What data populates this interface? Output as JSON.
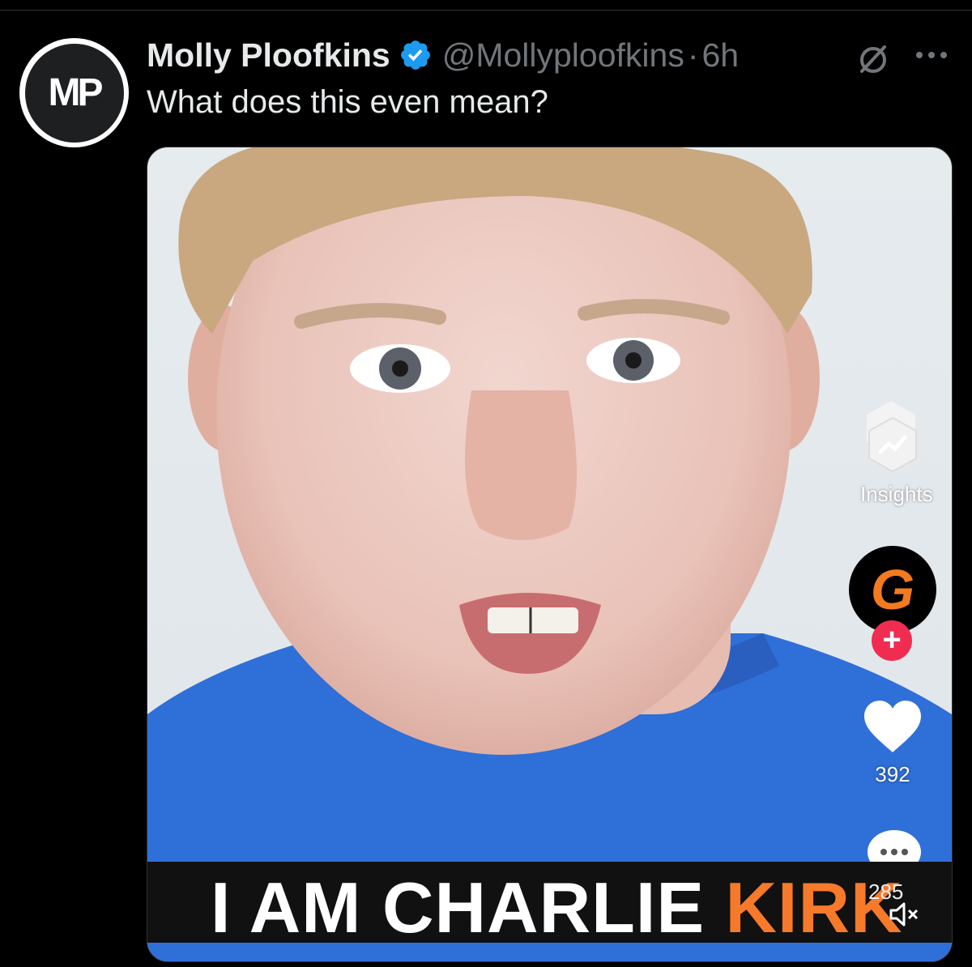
{
  "post": {
    "author_name": "Molly Ploofkins",
    "handle": "@Mollyploofkins",
    "separator": "·",
    "time": "6h",
    "text": "What does this even mean?",
    "avatar_initials": "MP"
  },
  "video": {
    "caption_main": "I AM CHARLIE ",
    "caption_accent": "KIRK",
    "insights_label": "Insights",
    "creator_logo": "G",
    "likes": "392",
    "comments": "285",
    "accent_color": "#f7792a",
    "shirt_color": "#2f6fd8"
  },
  "icons": [
    "verified-badge-icon",
    "grok-icon",
    "more-icon",
    "insights-icon",
    "heart-icon",
    "comment-icon",
    "mute-icon"
  ]
}
